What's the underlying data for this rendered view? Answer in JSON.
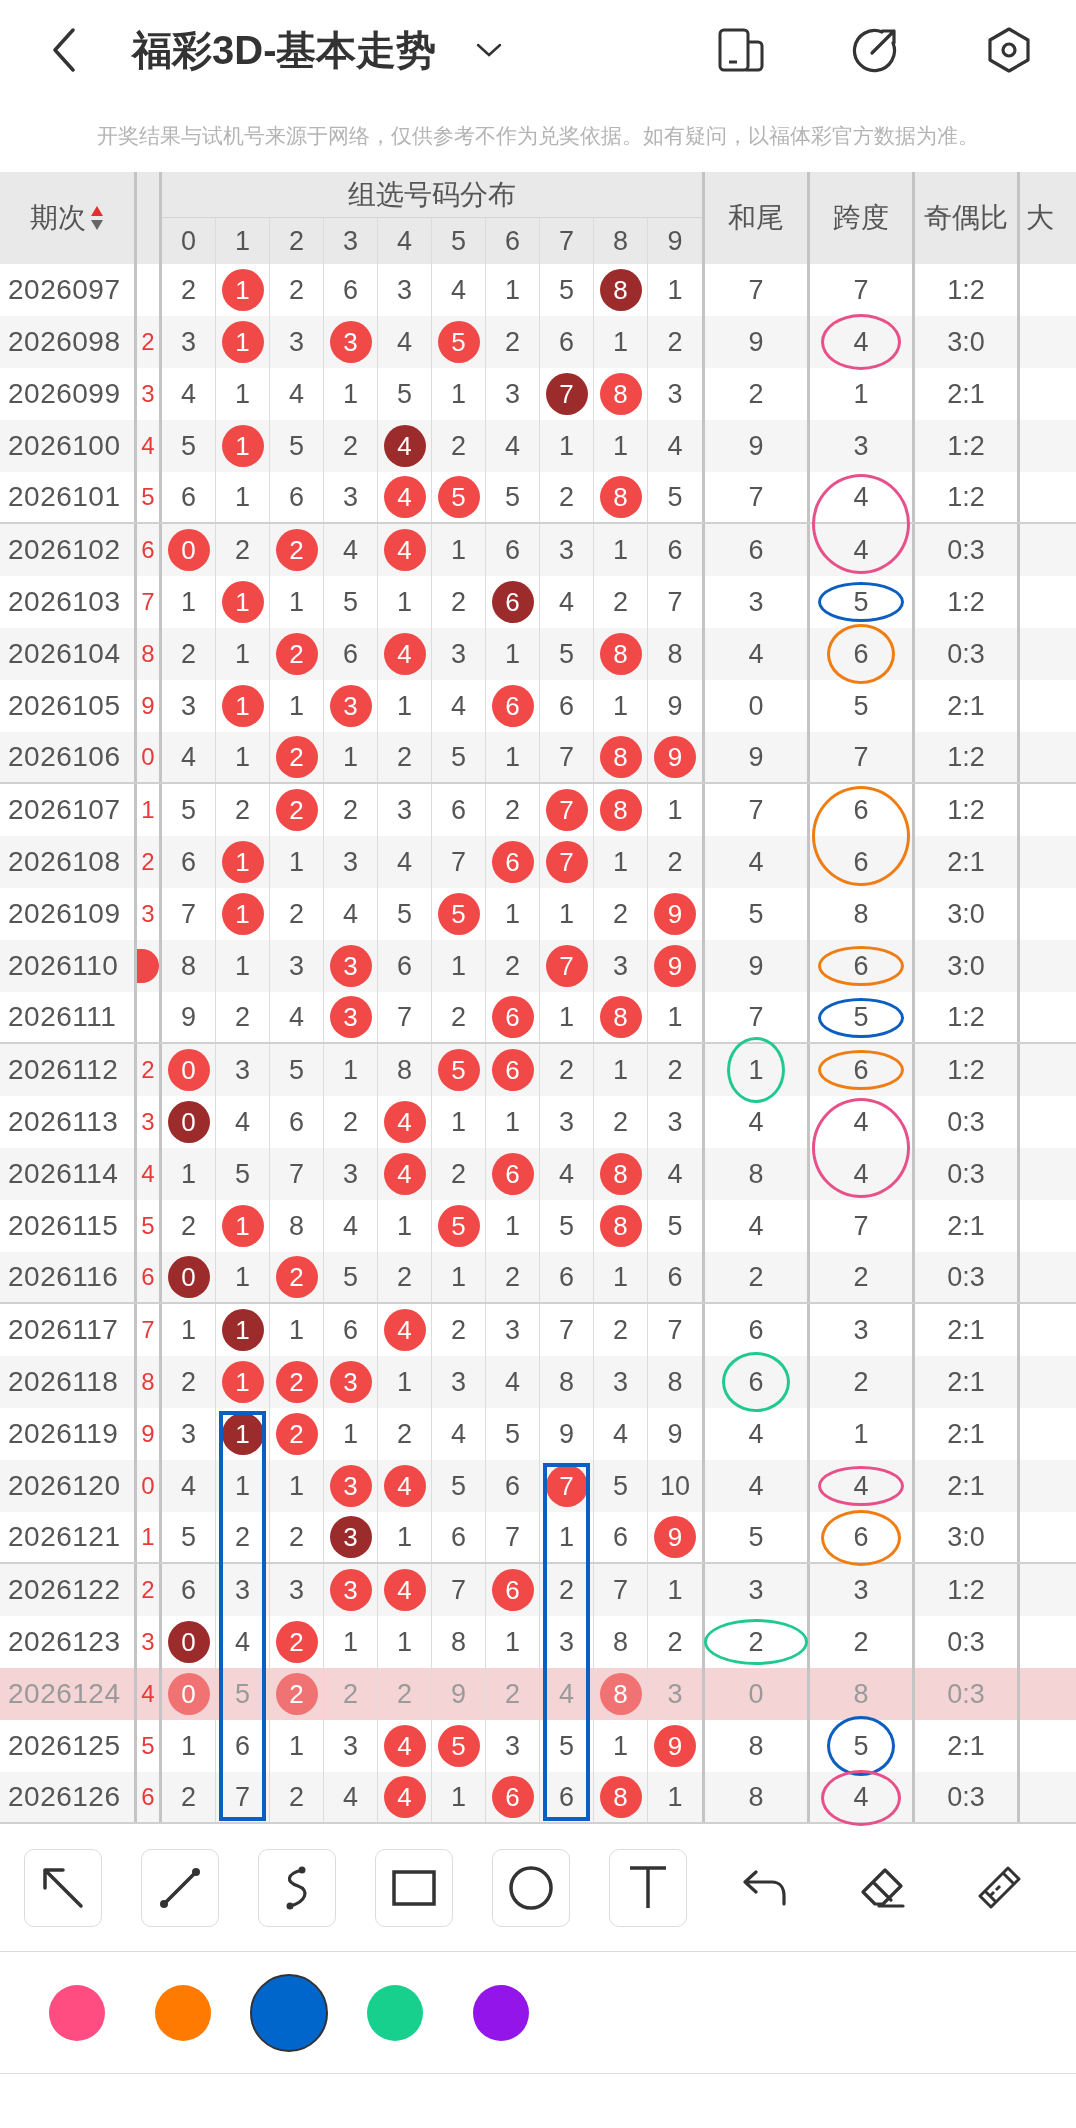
{
  "title": "福彩3D-基本走势",
  "notice": "开奖结果与试机号来源于网络，仅供参考不作为兑奖依据。如有疑问，以福体彩官方数据为准。",
  "columns": {
    "issue": "期次",
    "group": "组选号码分布",
    "digits": [
      "0",
      "1",
      "2",
      "3",
      "4",
      "5",
      "6",
      "7",
      "8",
      "9"
    ],
    "tail": "和尾",
    "span": "跨度",
    "ratio": "奇偶比",
    "column_cut": "大"
  },
  "rows": [
    {
      "issue": "2026097",
      "edge": {
        "kind": "none"
      },
      "cells": [
        {
          "number": "2",
          "kind": "plain"
        },
        {
          "number": "1",
          "kind": "red"
        },
        {
          "number": "2",
          "kind": "plain"
        },
        {
          "number": "6",
          "kind": "plain"
        },
        {
          "number": "3",
          "kind": "plain"
        },
        {
          "number": "4",
          "kind": "plain"
        },
        {
          "number": "1",
          "kind": "plain"
        },
        {
          "number": "5",
          "kind": "plain"
        },
        {
          "number": "8",
          "kind": "dark"
        },
        {
          "number": "1",
          "kind": "plain"
        }
      ],
      "tail": "7",
      "span": "7",
      "ratio": "1:2",
      "highlighted": false
    },
    {
      "issue": "2026098",
      "edge": {
        "kind": "text",
        "text": "2"
      },
      "cells": [
        {
          "number": "3",
          "kind": "plain"
        },
        {
          "number": "1",
          "kind": "red"
        },
        {
          "number": "3",
          "kind": "plain"
        },
        {
          "number": "3",
          "kind": "red"
        },
        {
          "number": "4",
          "kind": "plain"
        },
        {
          "number": "5",
          "kind": "red"
        },
        {
          "number": "2",
          "kind": "plain"
        },
        {
          "number": "6",
          "kind": "plain"
        },
        {
          "number": "1",
          "kind": "plain"
        },
        {
          "number": "2",
          "kind": "plain"
        }
      ],
      "tail": "9",
      "span": "4",
      "ratio": "3:0",
      "highlighted": false,
      "span_mark": {
        "kind": "ellipse",
        "color": "#e8508a"
      }
    },
    {
      "issue": "2026099",
      "edge": {
        "kind": "text",
        "text": "3"
      },
      "cells": [
        {
          "number": "4",
          "kind": "plain"
        },
        {
          "number": "1",
          "kind": "plain"
        },
        {
          "number": "4",
          "kind": "plain"
        },
        {
          "number": "1",
          "kind": "plain"
        },
        {
          "number": "5",
          "kind": "plain"
        },
        {
          "number": "1",
          "kind": "plain"
        },
        {
          "number": "3",
          "kind": "plain"
        },
        {
          "number": "7",
          "kind": "dark"
        },
        {
          "number": "8",
          "kind": "red"
        },
        {
          "number": "3",
          "kind": "plain"
        }
      ],
      "tail": "2",
      "span": "1",
      "ratio": "2:1",
      "highlighted": false
    },
    {
      "issue": "2026100",
      "edge": {
        "kind": "text",
        "text": "4"
      },
      "cells": [
        {
          "number": "5",
          "kind": "plain"
        },
        {
          "number": "1",
          "kind": "red"
        },
        {
          "number": "5",
          "kind": "plain"
        },
        {
          "number": "2",
          "kind": "plain"
        },
        {
          "number": "4",
          "kind": "dark"
        },
        {
          "number": "2",
          "kind": "plain"
        },
        {
          "number": "4",
          "kind": "plain"
        },
        {
          "number": "1",
          "kind": "plain"
        },
        {
          "number": "1",
          "kind": "plain"
        },
        {
          "number": "4",
          "kind": "plain"
        }
      ],
      "tail": "9",
      "span": "3",
      "ratio": "1:2",
      "highlighted": false
    },
    {
      "issue": "2026101",
      "edge": {
        "kind": "text",
        "text": "5"
      },
      "cells": [
        {
          "number": "6",
          "kind": "plain"
        },
        {
          "number": "1",
          "kind": "plain"
        },
        {
          "number": "6",
          "kind": "plain"
        },
        {
          "number": "3",
          "kind": "plain"
        },
        {
          "number": "4",
          "kind": "red"
        },
        {
          "number": "5",
          "kind": "red"
        },
        {
          "number": "5",
          "kind": "plain"
        },
        {
          "number": "2",
          "kind": "plain"
        },
        {
          "number": "8",
          "kind": "red"
        },
        {
          "number": "5",
          "kind": "plain"
        }
      ],
      "tail": "7",
      "span": "4",
      "ratio": "1:2",
      "highlighted": false,
      "span_mark": {
        "kind": "tall",
        "color": "#e8508a"
      }
    },
    {
      "issue": "2026102",
      "edge": {
        "kind": "text",
        "text": "6"
      },
      "cells": [
        {
          "number": "0",
          "kind": "red"
        },
        {
          "number": "2",
          "kind": "plain"
        },
        {
          "number": "2",
          "kind": "red"
        },
        {
          "number": "4",
          "kind": "plain"
        },
        {
          "number": "4",
          "kind": "red"
        },
        {
          "number": "1",
          "kind": "plain"
        },
        {
          "number": "6",
          "kind": "plain"
        },
        {
          "number": "3",
          "kind": "plain"
        },
        {
          "number": "1",
          "kind": "plain"
        },
        {
          "number": "6",
          "kind": "plain"
        }
      ],
      "tail": "6",
      "span": "4",
      "ratio": "0:3",
      "highlighted": false
    },
    {
      "issue": "2026103",
      "edge": {
        "kind": "text",
        "text": "7"
      },
      "cells": [
        {
          "number": "1",
          "kind": "plain"
        },
        {
          "number": "1",
          "kind": "red"
        },
        {
          "number": "1",
          "kind": "plain"
        },
        {
          "number": "5",
          "kind": "plain"
        },
        {
          "number": "1",
          "kind": "plain"
        },
        {
          "number": "2",
          "kind": "plain"
        },
        {
          "number": "6",
          "kind": "dark"
        },
        {
          "number": "4",
          "kind": "plain"
        },
        {
          "number": "2",
          "kind": "plain"
        },
        {
          "number": "7",
          "kind": "plain"
        }
      ],
      "tail": "3",
      "span": "5",
      "ratio": "1:2",
      "highlighted": false,
      "span_mark": {
        "kind": "wide",
        "color": "#0a5fc0"
      }
    },
    {
      "issue": "2026104",
      "edge": {
        "kind": "text",
        "text": "8"
      },
      "cells": [
        {
          "number": "2",
          "kind": "plain"
        },
        {
          "number": "1",
          "kind": "plain"
        },
        {
          "number": "2",
          "kind": "red"
        },
        {
          "number": "6",
          "kind": "plain"
        },
        {
          "number": "4",
          "kind": "red"
        },
        {
          "number": "3",
          "kind": "plain"
        },
        {
          "number": "1",
          "kind": "plain"
        },
        {
          "number": "5",
          "kind": "plain"
        },
        {
          "number": "8",
          "kind": "red"
        },
        {
          "number": "8",
          "kind": "plain"
        }
      ],
      "tail": "4",
      "span": "6",
      "ratio": "0:3",
      "highlighted": false,
      "span_mark": {
        "kind": "round",
        "color": "#f07d14"
      }
    },
    {
      "issue": "2026105",
      "edge": {
        "kind": "text",
        "text": "9"
      },
      "cells": [
        {
          "number": "3",
          "kind": "plain"
        },
        {
          "number": "1",
          "kind": "red"
        },
        {
          "number": "1",
          "kind": "plain"
        },
        {
          "number": "3",
          "kind": "red"
        },
        {
          "number": "1",
          "kind": "plain"
        },
        {
          "number": "4",
          "kind": "plain"
        },
        {
          "number": "6",
          "kind": "red"
        },
        {
          "number": "6",
          "kind": "plain"
        },
        {
          "number": "1",
          "kind": "plain"
        },
        {
          "number": "9",
          "kind": "plain"
        }
      ],
      "tail": "0",
      "span": "5",
      "ratio": "2:1",
      "highlighted": false
    },
    {
      "issue": "2026106",
      "edge": {
        "kind": "text",
        "text": "0"
      },
      "cells": [
        {
          "number": "4",
          "kind": "plain"
        },
        {
          "number": "1",
          "kind": "plain"
        },
        {
          "number": "2",
          "kind": "red"
        },
        {
          "number": "1",
          "kind": "plain"
        },
        {
          "number": "2",
          "kind": "plain"
        },
        {
          "number": "5",
          "kind": "plain"
        },
        {
          "number": "1",
          "kind": "plain"
        },
        {
          "number": "7",
          "kind": "plain"
        },
        {
          "number": "8",
          "kind": "red"
        },
        {
          "number": "9",
          "kind": "red"
        }
      ],
      "tail": "9",
      "span": "7",
      "ratio": "1:2",
      "highlighted": false
    },
    {
      "issue": "2026107",
      "edge": {
        "kind": "text",
        "text": "1"
      },
      "cells": [
        {
          "number": "5",
          "kind": "plain"
        },
        {
          "number": "2",
          "kind": "plain"
        },
        {
          "number": "2",
          "kind": "red"
        },
        {
          "number": "2",
          "kind": "plain"
        },
        {
          "number": "3",
          "kind": "plain"
        },
        {
          "number": "6",
          "kind": "plain"
        },
        {
          "number": "2",
          "kind": "plain"
        },
        {
          "number": "7",
          "kind": "red"
        },
        {
          "number": "8",
          "kind": "red"
        },
        {
          "number": "1",
          "kind": "plain"
        }
      ],
      "tail": "7",
      "span": "6",
      "ratio": "1:2",
      "highlighted": false,
      "span_mark": {
        "kind": "tall",
        "color": "#f07d14"
      }
    },
    {
      "issue": "2026108",
      "edge": {
        "kind": "text",
        "text": "2"
      },
      "cells": [
        {
          "number": "6",
          "kind": "plain"
        },
        {
          "number": "1",
          "kind": "red"
        },
        {
          "number": "1",
          "kind": "plain"
        },
        {
          "number": "3",
          "kind": "plain"
        },
        {
          "number": "4",
          "kind": "plain"
        },
        {
          "number": "7",
          "kind": "plain"
        },
        {
          "number": "6",
          "kind": "red"
        },
        {
          "number": "7",
          "kind": "red"
        },
        {
          "number": "1",
          "kind": "plain"
        },
        {
          "number": "2",
          "kind": "plain"
        }
      ],
      "tail": "4",
      "span": "6",
      "ratio": "2:1",
      "highlighted": false
    },
    {
      "issue": "2026109",
      "edge": {
        "kind": "text",
        "text": "3"
      },
      "cells": [
        {
          "number": "7",
          "kind": "plain"
        },
        {
          "number": "1",
          "kind": "red"
        },
        {
          "number": "2",
          "kind": "plain"
        },
        {
          "number": "4",
          "kind": "plain"
        },
        {
          "number": "5",
          "kind": "plain"
        },
        {
          "number": "5",
          "kind": "red"
        },
        {
          "number": "1",
          "kind": "plain"
        },
        {
          "number": "1",
          "kind": "plain"
        },
        {
          "number": "2",
          "kind": "plain"
        },
        {
          "number": "9",
          "kind": "red"
        }
      ],
      "tail": "5",
      "span": "8",
      "ratio": "3:0",
      "highlighted": false
    },
    {
      "issue": "2026110",
      "edge": {
        "kind": "ball"
      },
      "cells": [
        {
          "number": "8",
          "kind": "plain"
        },
        {
          "number": "1",
          "kind": "plain"
        },
        {
          "number": "3",
          "kind": "plain"
        },
        {
          "number": "3",
          "kind": "red"
        },
        {
          "number": "6",
          "kind": "plain"
        },
        {
          "number": "1",
          "kind": "plain"
        },
        {
          "number": "2",
          "kind": "plain"
        },
        {
          "number": "7",
          "kind": "red"
        },
        {
          "number": "3",
          "kind": "plain"
        },
        {
          "number": "9",
          "kind": "red"
        }
      ],
      "tail": "9",
      "span": "6",
      "ratio": "3:0",
      "highlighted": false,
      "span_mark": {
        "kind": "wide",
        "color": "#f07d14"
      }
    },
    {
      "issue": "2026111",
      "edge": {
        "kind": "none"
      },
      "cells": [
        {
          "number": "9",
          "kind": "plain"
        },
        {
          "number": "2",
          "kind": "plain"
        },
        {
          "number": "4",
          "kind": "plain"
        },
        {
          "number": "3",
          "kind": "red"
        },
        {
          "number": "7",
          "kind": "plain"
        },
        {
          "number": "2",
          "kind": "plain"
        },
        {
          "number": "6",
          "kind": "red"
        },
        {
          "number": "1",
          "kind": "plain"
        },
        {
          "number": "8",
          "kind": "red"
        },
        {
          "number": "1",
          "kind": "plain"
        }
      ],
      "tail": "7",
      "span": "5",
      "ratio": "1:2",
      "highlighted": false,
      "span_mark": {
        "kind": "wide",
        "color": "#0a5fc0"
      }
    },
    {
      "issue": "2026112",
      "edge": {
        "kind": "text",
        "text": "2"
      },
      "cells": [
        {
          "number": "0",
          "kind": "red"
        },
        {
          "number": "3",
          "kind": "plain"
        },
        {
          "number": "5",
          "kind": "plain"
        },
        {
          "number": "1",
          "kind": "plain"
        },
        {
          "number": "8",
          "kind": "plain"
        },
        {
          "number": "5",
          "kind": "red"
        },
        {
          "number": "6",
          "kind": "red"
        },
        {
          "number": "2",
          "kind": "plain"
        },
        {
          "number": "1",
          "kind": "plain"
        },
        {
          "number": "2",
          "kind": "plain"
        }
      ],
      "tail": "1",
      "span": "6",
      "ratio": "1:2",
      "highlighted": false,
      "tail_mark": {
        "kind": "upright",
        "color": "#22c98f"
      },
      "span_mark": {
        "kind": "wide",
        "color": "#f07d14"
      }
    },
    {
      "issue": "2026113",
      "edge": {
        "kind": "text",
        "text": "3"
      },
      "cells": [
        {
          "number": "0",
          "kind": "dark"
        },
        {
          "number": "4",
          "kind": "plain"
        },
        {
          "number": "6",
          "kind": "plain"
        },
        {
          "number": "2",
          "kind": "plain"
        },
        {
          "number": "4",
          "kind": "red"
        },
        {
          "number": "1",
          "kind": "plain"
        },
        {
          "number": "1",
          "kind": "plain"
        },
        {
          "number": "3",
          "kind": "plain"
        },
        {
          "number": "2",
          "kind": "plain"
        },
        {
          "number": "3",
          "kind": "plain"
        }
      ],
      "tail": "4",
      "span": "4",
      "ratio": "0:3",
      "highlighted": false,
      "span_mark": {
        "kind": "tall",
        "color": "#e8508a"
      }
    },
    {
      "issue": "2026114",
      "edge": {
        "kind": "text",
        "text": "4"
      },
      "cells": [
        {
          "number": "1",
          "kind": "plain"
        },
        {
          "number": "5",
          "kind": "plain"
        },
        {
          "number": "7",
          "kind": "plain"
        },
        {
          "number": "3",
          "kind": "plain"
        },
        {
          "number": "4",
          "kind": "red"
        },
        {
          "number": "2",
          "kind": "plain"
        },
        {
          "number": "6",
          "kind": "red"
        },
        {
          "number": "4",
          "kind": "plain"
        },
        {
          "number": "8",
          "kind": "red"
        },
        {
          "number": "4",
          "kind": "plain"
        }
      ],
      "tail": "8",
      "span": "4",
      "ratio": "0:3",
      "highlighted": false
    },
    {
      "issue": "2026115",
      "edge": {
        "kind": "text",
        "text": "5"
      },
      "cells": [
        {
          "number": "2",
          "kind": "plain"
        },
        {
          "number": "1",
          "kind": "red"
        },
        {
          "number": "8",
          "kind": "plain"
        },
        {
          "number": "4",
          "kind": "plain"
        },
        {
          "number": "1",
          "kind": "plain"
        },
        {
          "number": "5",
          "kind": "red"
        },
        {
          "number": "1",
          "kind": "plain"
        },
        {
          "number": "5",
          "kind": "plain"
        },
        {
          "number": "8",
          "kind": "red"
        },
        {
          "number": "5",
          "kind": "plain"
        }
      ],
      "tail": "4",
      "span": "7",
      "ratio": "2:1",
      "highlighted": false
    },
    {
      "issue": "2026116",
      "edge": {
        "kind": "text",
        "text": "6"
      },
      "cells": [
        {
          "number": "0",
          "kind": "dark"
        },
        {
          "number": "1",
          "kind": "plain"
        },
        {
          "number": "2",
          "kind": "red"
        },
        {
          "number": "5",
          "kind": "plain"
        },
        {
          "number": "2",
          "kind": "plain"
        },
        {
          "number": "1",
          "kind": "plain"
        },
        {
          "number": "2",
          "kind": "plain"
        },
        {
          "number": "6",
          "kind": "plain"
        },
        {
          "number": "1",
          "kind": "plain"
        },
        {
          "number": "6",
          "kind": "plain"
        }
      ],
      "tail": "2",
      "span": "2",
      "ratio": "0:3",
      "highlighted": false
    },
    {
      "issue": "2026117",
      "edge": {
        "kind": "text",
        "text": "7"
      },
      "cells": [
        {
          "number": "1",
          "kind": "plain"
        },
        {
          "number": "1",
          "kind": "dark"
        },
        {
          "number": "1",
          "kind": "plain"
        },
        {
          "number": "6",
          "kind": "plain"
        },
        {
          "number": "4",
          "kind": "red"
        },
        {
          "number": "2",
          "kind": "plain"
        },
        {
          "number": "3",
          "kind": "plain"
        },
        {
          "number": "7",
          "kind": "plain"
        },
        {
          "number": "2",
          "kind": "plain"
        },
        {
          "number": "7",
          "kind": "plain"
        }
      ],
      "tail": "6",
      "span": "3",
      "ratio": "2:1",
      "highlighted": false
    },
    {
      "issue": "2026118",
      "edge": {
        "kind": "text",
        "text": "8"
      },
      "cells": [
        {
          "number": "2",
          "kind": "plain"
        },
        {
          "number": "1",
          "kind": "red"
        },
        {
          "number": "2",
          "kind": "red"
        },
        {
          "number": "3",
          "kind": "red"
        },
        {
          "number": "1",
          "kind": "plain"
        },
        {
          "number": "3",
          "kind": "plain"
        },
        {
          "number": "4",
          "kind": "plain"
        },
        {
          "number": "8",
          "kind": "plain"
        },
        {
          "number": "3",
          "kind": "plain"
        },
        {
          "number": "8",
          "kind": "plain"
        }
      ],
      "tail": "6",
      "span": "2",
      "ratio": "2:1",
      "highlighted": false,
      "tail_mark": {
        "kind": "round",
        "color": "#22c98f"
      }
    },
    {
      "issue": "2026119",
      "edge": {
        "kind": "text",
        "text": "9"
      },
      "cells": [
        {
          "number": "3",
          "kind": "plain"
        },
        {
          "number": "1",
          "kind": "dark",
          "box": {
            "color": "#0a5fc0"
          }
        },
        {
          "number": "2",
          "kind": "red"
        },
        {
          "number": "1",
          "kind": "plain"
        },
        {
          "number": "2",
          "kind": "plain"
        },
        {
          "number": "4",
          "kind": "plain"
        },
        {
          "number": "5",
          "kind": "plain"
        },
        {
          "number": "9",
          "kind": "plain"
        },
        {
          "number": "4",
          "kind": "plain"
        },
        {
          "number": "9",
          "kind": "plain"
        }
      ],
      "tail": "4",
      "span": "1",
      "ratio": "2:1",
      "highlighted": false
    },
    {
      "issue": "2026120",
      "edge": {
        "kind": "text",
        "text": "0"
      },
      "cells": [
        {
          "number": "4",
          "kind": "plain"
        },
        {
          "number": "1",
          "kind": "plain"
        },
        {
          "number": "1",
          "kind": "plain"
        },
        {
          "number": "3",
          "kind": "red"
        },
        {
          "number": "4",
          "kind": "red"
        },
        {
          "number": "5",
          "kind": "plain"
        },
        {
          "number": "6",
          "kind": "plain"
        },
        {
          "number": "7",
          "kind": "red",
          "box": {
            "color": "#0a5fc0"
          }
        },
        {
          "number": "5",
          "kind": "plain"
        },
        {
          "number": "10",
          "kind": "plain"
        }
      ],
      "tail": "4",
      "span": "4",
      "ratio": "2:1",
      "highlighted": false,
      "span_mark": {
        "kind": "wide",
        "color": "#e8508a"
      }
    },
    {
      "issue": "2026121",
      "edge": {
        "kind": "text",
        "text": "1"
      },
      "cells": [
        {
          "number": "5",
          "kind": "plain"
        },
        {
          "number": "2",
          "kind": "plain"
        },
        {
          "number": "2",
          "kind": "plain"
        },
        {
          "number": "3",
          "kind": "dark"
        },
        {
          "number": "1",
          "kind": "plain"
        },
        {
          "number": "6",
          "kind": "plain"
        },
        {
          "number": "7",
          "kind": "plain"
        },
        {
          "number": "1",
          "kind": "plain"
        },
        {
          "number": "6",
          "kind": "plain"
        },
        {
          "number": "9",
          "kind": "red"
        }
      ],
      "tail": "5",
      "span": "6",
      "ratio": "3:0",
      "highlighted": false,
      "span_mark": {
        "kind": "ellipse",
        "color": "#f07d14"
      }
    },
    {
      "issue": "2026122",
      "edge": {
        "kind": "text",
        "text": "2"
      },
      "cells": [
        {
          "number": "6",
          "kind": "plain"
        },
        {
          "number": "3",
          "kind": "plain"
        },
        {
          "number": "3",
          "kind": "plain"
        },
        {
          "number": "3",
          "kind": "red"
        },
        {
          "number": "4",
          "kind": "red"
        },
        {
          "number": "7",
          "kind": "plain"
        },
        {
          "number": "6",
          "kind": "red"
        },
        {
          "number": "2",
          "kind": "plain"
        },
        {
          "number": "7",
          "kind": "plain"
        },
        {
          "number": "1",
          "kind": "plain"
        }
      ],
      "tail": "3",
      "span": "3",
      "ratio": "1:2",
      "highlighted": false
    },
    {
      "issue": "2026123",
      "edge": {
        "kind": "text",
        "text": "3"
      },
      "cells": [
        {
          "number": "0",
          "kind": "dark"
        },
        {
          "number": "4",
          "kind": "plain"
        },
        {
          "number": "2",
          "kind": "red"
        },
        {
          "number": "1",
          "kind": "plain"
        },
        {
          "number": "1",
          "kind": "plain"
        },
        {
          "number": "8",
          "kind": "plain"
        },
        {
          "number": "1",
          "kind": "plain"
        },
        {
          "number": "3",
          "kind": "plain"
        },
        {
          "number": "8",
          "kind": "plain"
        },
        {
          "number": "2",
          "kind": "plain"
        }
      ],
      "tail": "2",
      "span": "2",
      "ratio": "0:3",
      "highlighted": false,
      "tail_mark": {
        "kind": "long",
        "color": "#22c98f"
      }
    },
    {
      "issue": "2026124",
      "edge": {
        "kind": "text",
        "text": "4"
      },
      "cells": [
        {
          "number": "0",
          "kind": "red"
        },
        {
          "number": "5",
          "kind": "plain"
        },
        {
          "number": "2",
          "kind": "red"
        },
        {
          "number": "2",
          "kind": "plain"
        },
        {
          "number": "2",
          "kind": "plain"
        },
        {
          "number": "9",
          "kind": "plain"
        },
        {
          "number": "2",
          "kind": "plain"
        },
        {
          "number": "4",
          "kind": "plain"
        },
        {
          "number": "8",
          "kind": "red"
        },
        {
          "number": "3",
          "kind": "plain"
        }
      ],
      "tail": "0",
      "span": "8",
      "ratio": "0:3",
      "highlighted": true
    },
    {
      "issue": "2026125",
      "edge": {
        "kind": "text",
        "text": "5"
      },
      "cells": [
        {
          "number": "1",
          "kind": "plain"
        },
        {
          "number": "6",
          "kind": "plain"
        },
        {
          "number": "1",
          "kind": "plain"
        },
        {
          "number": "3",
          "kind": "plain"
        },
        {
          "number": "4",
          "kind": "red"
        },
        {
          "number": "5",
          "kind": "red"
        },
        {
          "number": "3",
          "kind": "plain"
        },
        {
          "number": "5",
          "kind": "plain"
        },
        {
          "number": "1",
          "kind": "plain"
        },
        {
          "number": "9",
          "kind": "red"
        }
      ],
      "tail": "8",
      "span": "5",
      "ratio": "2:1",
      "highlighted": false,
      "span_mark": {
        "kind": "round",
        "color": "#0a5fc0"
      }
    },
    {
      "issue": "2026126",
      "edge": {
        "kind": "text",
        "text": "6"
      },
      "cells": [
        {
          "number": "2",
          "kind": "plain"
        },
        {
          "number": "7",
          "kind": "plain"
        },
        {
          "number": "2",
          "kind": "plain"
        },
        {
          "number": "4",
          "kind": "plain"
        },
        {
          "number": "4",
          "kind": "red"
        },
        {
          "number": "1",
          "kind": "plain"
        },
        {
          "number": "6",
          "kind": "red"
        },
        {
          "number": "6",
          "kind": "plain"
        },
        {
          "number": "8",
          "kind": "red"
        },
        {
          "number": "1",
          "kind": "plain"
        }
      ],
      "tail": "8",
      "span": "4",
      "ratio": "0:3",
      "highlighted": false,
      "span_mark": {
        "kind": "ellipse",
        "color": "#e8508a"
      }
    }
  ],
  "tools": [
    {
      "kind": "arrow"
    },
    {
      "kind": "line"
    },
    {
      "kind": "curve"
    },
    {
      "kind": "rectangle"
    },
    {
      "kind": "circle"
    },
    {
      "kind": "text"
    },
    {
      "kind": "undo"
    },
    {
      "kind": "eraser"
    },
    {
      "kind": "brush"
    }
  ],
  "colors": [
    {
      "color": "#ff4d82",
      "selected": false
    },
    {
      "color": "#ff7a00",
      "selected": false
    },
    {
      "color": "#0066cc",
      "selected": true
    },
    {
      "color": "#18d08e",
      "selected": false
    },
    {
      "color": "#9315ea",
      "selected": false
    }
  ]
}
